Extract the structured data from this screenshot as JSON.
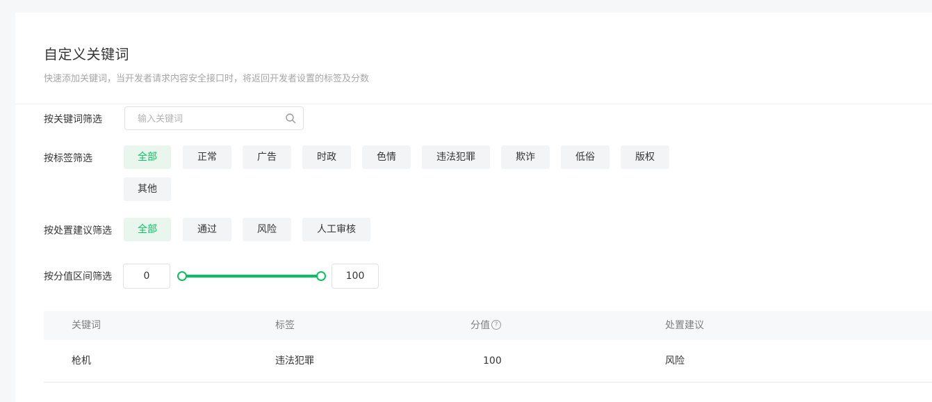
{
  "header": {
    "title": "自定义关键词",
    "description": "快速添加关键词，当开发者请求内容安全接口时，将返回开发者设置的标签及分数"
  },
  "filters": {
    "keyword": {
      "label": "按关键词筛选",
      "placeholder": "输入关键词"
    },
    "tag": {
      "label": "按标签筛选",
      "options": [
        "全部",
        "正常",
        "广告",
        "时政",
        "色情",
        "违法犯罪",
        "欺诈",
        "低俗",
        "版权",
        "其他"
      ],
      "selected": "全部"
    },
    "suggestion": {
      "label": "按处置建议筛选",
      "options": [
        "全部",
        "通过",
        "风险",
        "人工审核"
      ],
      "selected": "全部"
    },
    "score": {
      "label": "按分值区间筛选",
      "min": "0",
      "max": "100"
    }
  },
  "table": {
    "columns": [
      "关键词",
      "标签",
      "分值",
      "处置建议"
    ],
    "help_icon_text": "?",
    "rows": [
      {
        "keyword": "枪机",
        "tag": "违法犯罪",
        "score": "100",
        "suggestion": "风险"
      }
    ]
  },
  "colors": {
    "accent": "#07c160",
    "accent_bg": "#e8f6ee",
    "chip_bg": "#f3f4f5"
  }
}
